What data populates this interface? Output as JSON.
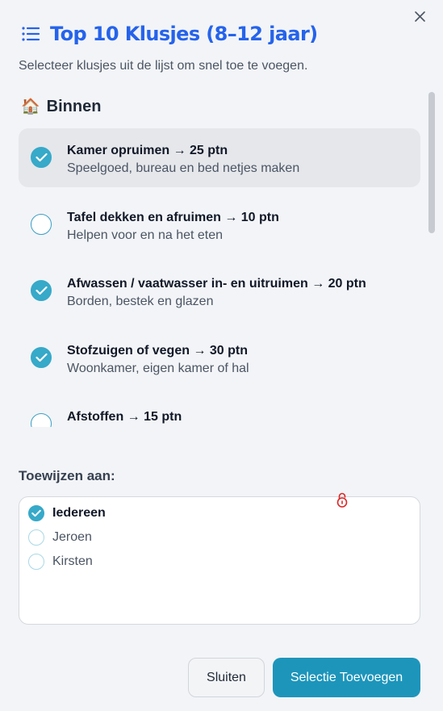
{
  "dialog": {
    "title": "Top 10 Klusjes (8–12 jaar)",
    "subtitle": "Selecteer klusjes uit de lijst om snel toe te voegen."
  },
  "section": {
    "label": "Binnen",
    "icon": "house-icon"
  },
  "chores": [
    {
      "title": "Kamer opruimen → 25 ptn",
      "desc": "Speelgoed, bureau en bed netjes maken",
      "checked": true
    },
    {
      "title": "Tafel dekken en afruimen → 10 ptn",
      "desc": "Helpen voor en na het eten",
      "checked": false
    },
    {
      "title": "Afwassen / vaatwasser in- en uitruimen → 20 ptn",
      "desc": "Borden, bestek en glazen",
      "checked": true
    },
    {
      "title": "Stofzuigen of vegen → 30 ptn",
      "desc": "Woonkamer, eigen kamer of hal",
      "checked": true
    },
    {
      "title": "Afstoffen → 15 ptn",
      "desc": "",
      "checked": false
    }
  ],
  "assign": {
    "label": "Toewijzen aan:",
    "people": [
      {
        "name": "Iedereen",
        "selected": true
      },
      {
        "name": "Jeroen",
        "selected": false
      },
      {
        "name": "Kirsten",
        "selected": false
      }
    ]
  },
  "buttons": {
    "close": "Sluiten",
    "add": "Selectie Toevoegen"
  },
  "colors": {
    "accent": "#2563eb",
    "teal": "#1d95bb",
    "check": "#37a9c9",
    "lock": "#dc2626"
  }
}
